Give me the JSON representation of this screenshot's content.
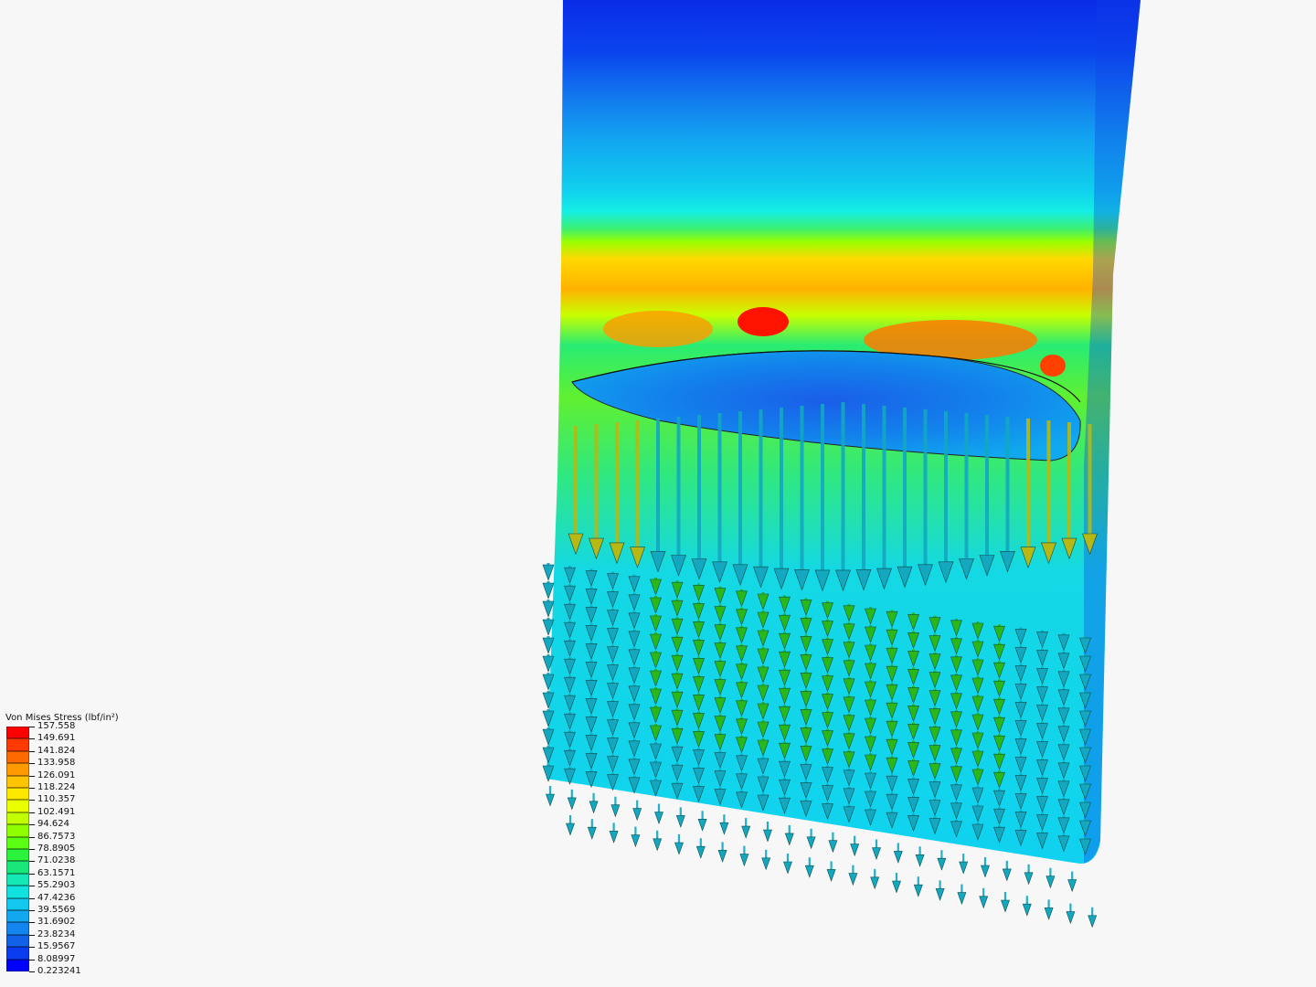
{
  "legend": {
    "title": "Von Mises Stress (lbf/in²)",
    "ticks": [
      "157.558",
      "149.691",
      "141.824",
      "133.958",
      "126.091",
      "118.224",
      "110.357",
      "102.491",
      "94.624",
      "86.7573",
      "78.8905",
      "71.0238",
      "63.1571",
      "55.2903",
      "47.4236",
      "39.5569",
      "31.6902",
      "23.8234",
      "15.9567",
      "8.08997",
      "0.223241"
    ],
    "colors": [
      "#ff0000",
      "#ff3a00",
      "#ff6a00",
      "#ff9a00",
      "#ffc400",
      "#ffe800",
      "#eaff00",
      "#c2ff00",
      "#8fff00",
      "#5aff14",
      "#2bf23a",
      "#18e87a",
      "#14e8b4",
      "#10e2e0",
      "#12c8ee",
      "#12a8f0",
      "#1286ee",
      "#1262e8",
      "#0a3cf0",
      "#0000ff"
    ]
  },
  "model": {
    "top_color": "#0a38e8",
    "mid_color": "#10dcf0",
    "hot_band_color": "#ffb400",
    "peak_color": "#ff1000",
    "arrow_blue": "#13a8c0",
    "arrow_green": "#2ab818",
    "arrow_yellow": "#b8b814"
  }
}
